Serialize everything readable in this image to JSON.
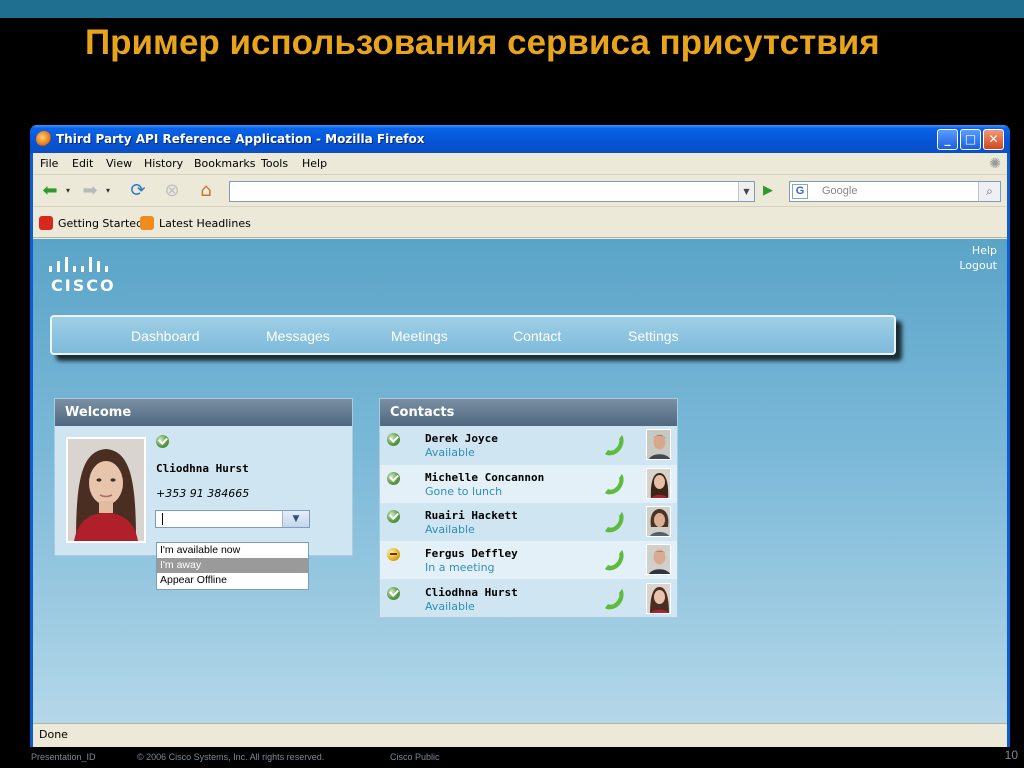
{
  "slide": {
    "title": "Пример использования сервиса присутствия",
    "footer_id": "Presentation_ID",
    "copyright": "© 2006 Cisco Systems, Inc. All rights reserved.",
    "classification": "Cisco Public",
    "page_number": "10"
  },
  "browser": {
    "window_title": "Third Party API Reference Application - Mozilla Firefox",
    "menu": [
      "File",
      "Edit",
      "View",
      "History",
      "Bookmarks",
      "Tools",
      "Help"
    ],
    "search_placeholder": "Google",
    "bookmarks": [
      "Getting Started",
      "Latest Headlines"
    ],
    "status_text": "Done"
  },
  "app": {
    "logo_text": "CISCO",
    "top_links": [
      "Help",
      "Logout"
    ],
    "nav": [
      "Dashboard",
      "Messages",
      "Meetings",
      "Contact",
      "Settings"
    ],
    "welcome": {
      "header": "Welcome",
      "name": "Cliodhna Hurst",
      "phone": "+353 91 384665",
      "status_icon": "available",
      "options": [
        "I'm available now",
        "I'm away",
        "Appear Offline"
      ],
      "selected_option": "I'm away"
    },
    "contacts": {
      "header": "Contacts",
      "items": [
        {
          "name": "Derek Joyce",
          "status": "Available",
          "presence": "available"
        },
        {
          "name": "Michelle Concannon",
          "status": "Gone to lunch",
          "presence": "available"
        },
        {
          "name": "Ruairi Hackett",
          "status": "Available",
          "presence": "available"
        },
        {
          "name": "Fergus Deffley",
          "status": "In a meeting",
          "presence": "away"
        },
        {
          "name": "Cliodhna Hurst",
          "status": "Available",
          "presence": "available"
        }
      ]
    }
  },
  "colors": {
    "slide_title": "#e8a51a",
    "titlebar": "#0554d6",
    "content_bg": "#7cb9d8",
    "status_link": "#2f8fb8"
  }
}
